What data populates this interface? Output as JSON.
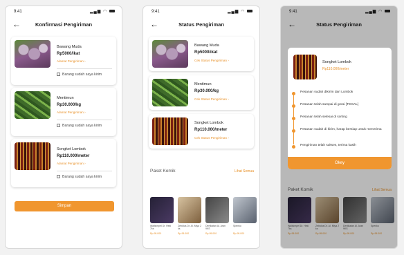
{
  "screens": [
    {
      "time": "9:41",
      "title": "Konfirmasi Pengiriman",
      "items": [
        {
          "name": "Bawang Muda",
          "price": "Rp5000/ikat",
          "link": "Alamat Pengiriman ›",
          "checkbox": "Barang sudah saya kirim"
        },
        {
          "name": "Mentimun",
          "price": "Rp30.000/kg",
          "link": "Alamat Pengiriman ›",
          "checkbox": "Barang sudah saya kirim"
        },
        {
          "name": "Songket Lombok",
          "price": "Rp110.000/meter",
          "link": "Alamat Pengiriman ›",
          "checkbox": "Barang sudah saya kirim"
        }
      ],
      "button": "Simpan"
    },
    {
      "time": "9:41",
      "title": "Status Pengiriman",
      "items": [
        {
          "name": "Bawang Muda",
          "price": "Rp5000/ikat",
          "link": "Cek Status Pengiriman ›"
        },
        {
          "name": "Mentimun",
          "price": "Rp30.000/kg",
          "link": "Cek Status Pengiriman ›"
        },
        {
          "name": "Songket Lombok",
          "price": "Rp110.000/meter",
          "link": "Cek Status Pengiriman ›"
        }
      ],
      "section_title": "Paket Komik",
      "section_link": "Lihat Semua",
      "packages": [
        {
          "name": "Wallsimpel Dr. Heki 7ks",
          "price": "Rp.95.000"
        },
        {
          "name": "Zebidus Dr. Al. Miya 2 ks",
          "price": "Rp.95.000"
        },
        {
          "name": "Dertikatan Al. Aran 9KS",
          "price": "Rp.95.000"
        },
        {
          "name": "Spenko",
          "price": "Rp.95.000"
        }
      ]
    },
    {
      "time": "9:41",
      "title": "Status Pengiriman",
      "modal": {
        "name": "Songket Lombok",
        "price": "Rp110.000/meter",
        "statuses": [
          "Pesanan sudah dikirim dari Lombok",
          "Pesanan telah sampai di gerai [TEGAL]",
          "Pesanan telah selesai di sorting",
          "Pesanan sudah di kirim, harap bersiap untuk menerima",
          "Pengiriman telah sukses, terima kasih"
        ],
        "button": "Okey"
      },
      "section_title": "Paket Komik",
      "section_link": "Lihat Semua",
      "packages": [
        {
          "name": "Wallsimpel Dr. Heki 7ks",
          "price": "Rp.95.000"
        },
        {
          "name": "Zebidus Dr. Al. Miya 2 ks",
          "price": "Rp.95.000"
        },
        {
          "name": "Dertikatan Al. Aran 9KS",
          "price": "Rp.95.000"
        },
        {
          "name": "Spenko",
          "price": "Rp.95.000"
        }
      ]
    }
  ],
  "colors": {
    "accent": "#f0962f",
    "link": "#e8922b"
  }
}
